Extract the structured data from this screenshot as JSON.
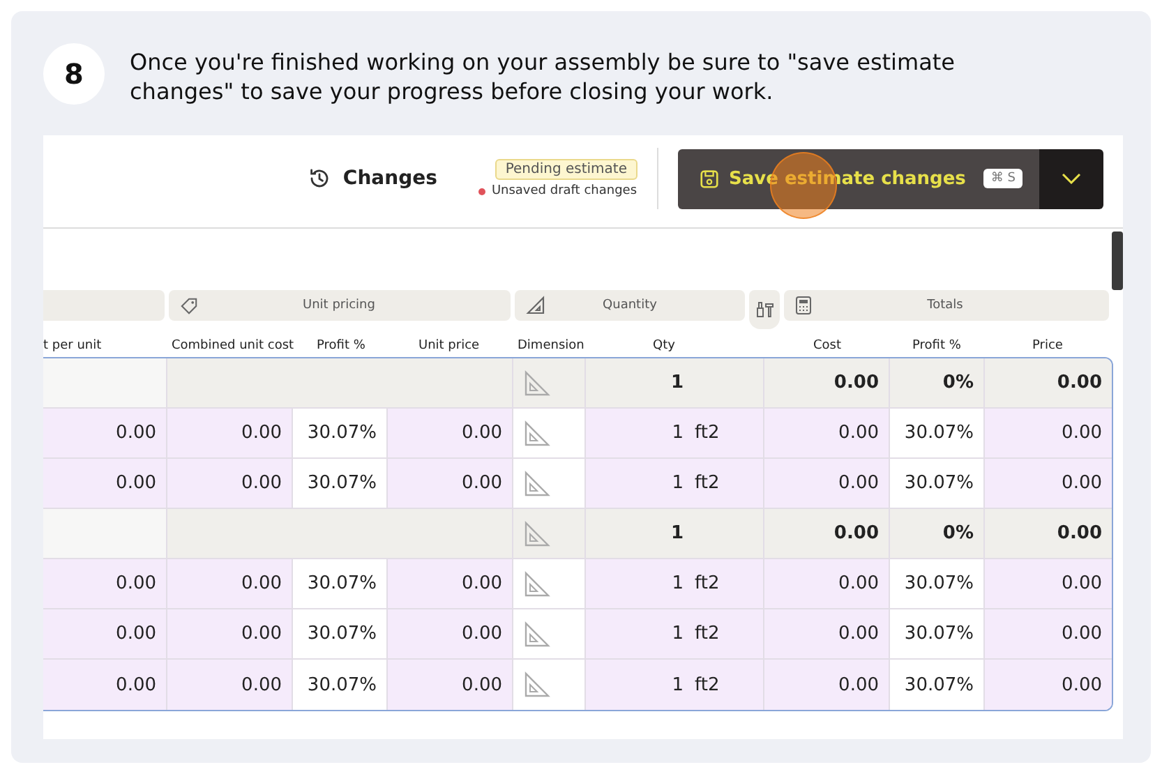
{
  "step": {
    "number": "8",
    "text": "Once you're finished working on your assembly be sure to \"save estimate changes\" to save your progress before closing your work."
  },
  "toolbar": {
    "changes": "Changes",
    "badge": "Pending estimate",
    "note": "Unsaved draft changes",
    "save_button": "Save estimate changes",
    "shortcut": "⌘ S"
  },
  "column_groups": [
    "Unit pricing",
    "Quantity",
    "Totals"
  ],
  "columns": [
    "t per unit",
    "Combined unit cost",
    "Profit %",
    "Unit price",
    "Dimension",
    "Qty",
    "Cost",
    "Profit %",
    "Price"
  ],
  "rows": [
    {
      "kind": "group",
      "qty": "1",
      "cost": "0.00",
      "profit": "0%",
      "price": "0.00"
    },
    {
      "kind": "item",
      "per_unit": "0.00",
      "combined": "0.00",
      "unit_profit": "30.07%",
      "unit_price": "0.00",
      "qty": "1",
      "unit": "ft2",
      "cost": "0.00",
      "profit": "30.07%",
      "price": "0.00"
    },
    {
      "kind": "item",
      "per_unit": "0.00",
      "combined": "0.00",
      "unit_profit": "30.07%",
      "unit_price": "0.00",
      "qty": "1",
      "unit": "ft2",
      "cost": "0.00",
      "profit": "30.07%",
      "price": "0.00"
    },
    {
      "kind": "group",
      "qty": "1",
      "cost": "0.00",
      "profit": "0%",
      "price": "0.00"
    },
    {
      "kind": "item",
      "per_unit": "0.00",
      "combined": "0.00",
      "unit_profit": "30.07%",
      "unit_price": "0.00",
      "qty": "1",
      "unit": "ft2",
      "cost": "0.00",
      "profit": "30.07%",
      "price": "0.00"
    },
    {
      "kind": "item",
      "per_unit": "0.00",
      "combined": "0.00",
      "unit_profit": "30.07%",
      "unit_price": "0.00",
      "qty": "1",
      "unit": "ft2",
      "cost": "0.00",
      "profit": "30.07%",
      "price": "0.00"
    },
    {
      "kind": "item",
      "per_unit": "0.00",
      "combined": "0.00",
      "unit_profit": "30.07%",
      "unit_price": "0.00",
      "qty": "1",
      "unit": "ft2",
      "cost": "0.00",
      "profit": "30.07%",
      "price": "0.00"
    }
  ]
}
